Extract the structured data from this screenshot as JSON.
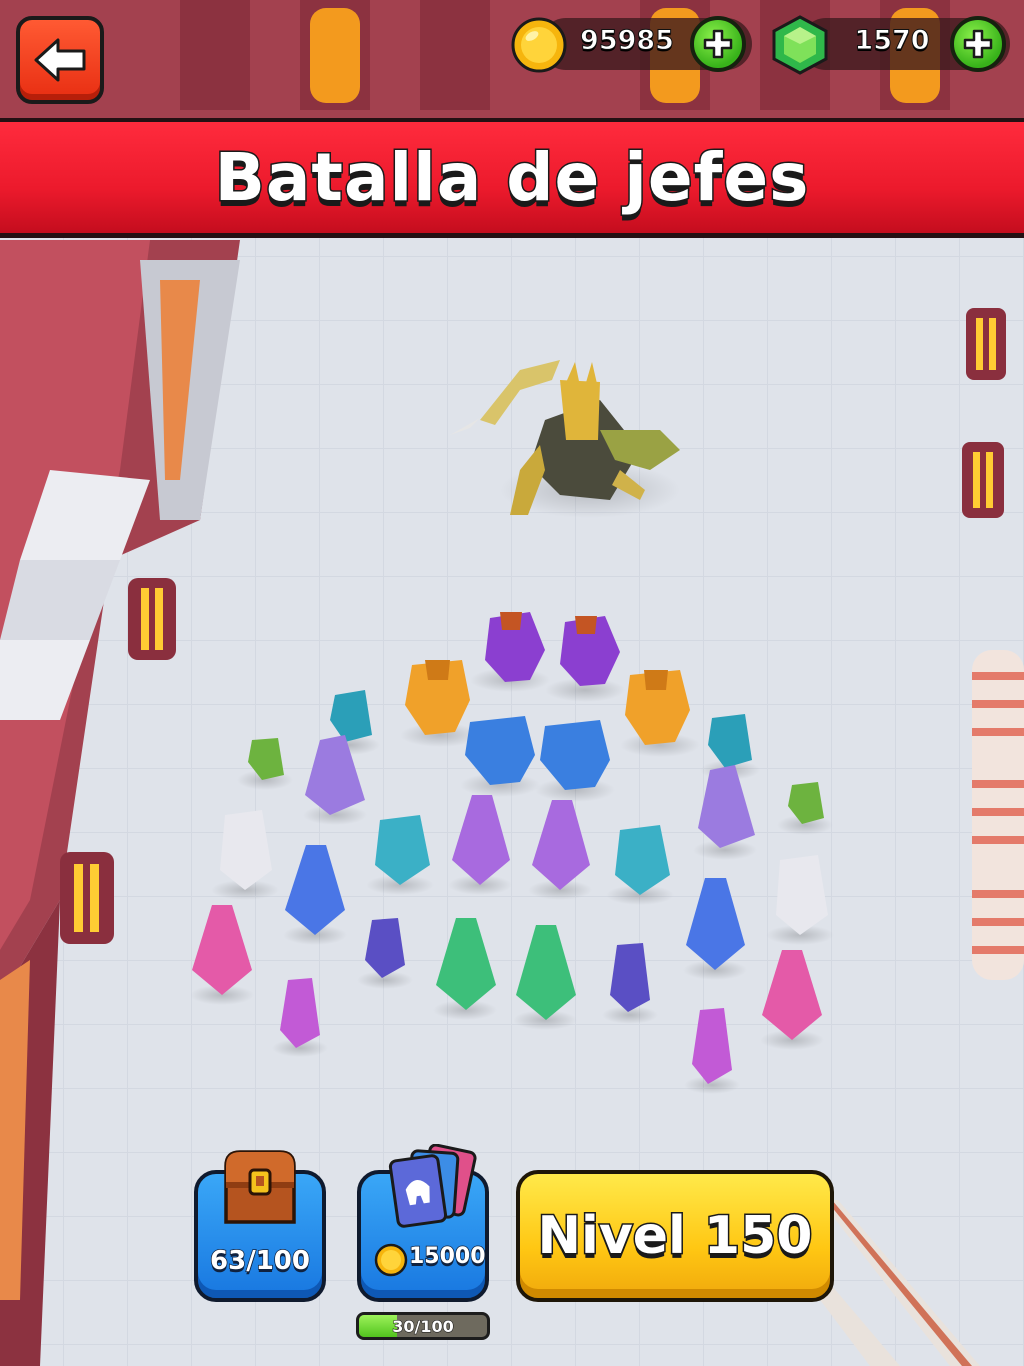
{
  "header": {
    "back_icon": "arrow-left-icon",
    "coins": {
      "icon": "coin-icon",
      "value": "95985",
      "add_icon": "plus-icon"
    },
    "gems": {
      "icon": "gem-icon",
      "value": "1570",
      "add_icon": "plus-icon"
    }
  },
  "banner": {
    "title": "Batalla de jefes"
  },
  "bottom": {
    "chest": {
      "icon": "chest-icon",
      "label": "63/100"
    },
    "cards": {
      "icon": "cards-icon",
      "coin_icon": "coin-icon",
      "cost": "15000",
      "progress_label": "30/100",
      "progress": 0.3
    },
    "level_button": {
      "label": "Nivel 150"
    }
  },
  "colors": {
    "banner_red": "#ec1a2c",
    "back_button": "#f0401f",
    "blue_button": "#2a8ff0",
    "yellow_button": "#ffcf1e",
    "plus_green": "#44bf1f",
    "floor": "#dfe3ea",
    "walls": "#a3414f"
  }
}
